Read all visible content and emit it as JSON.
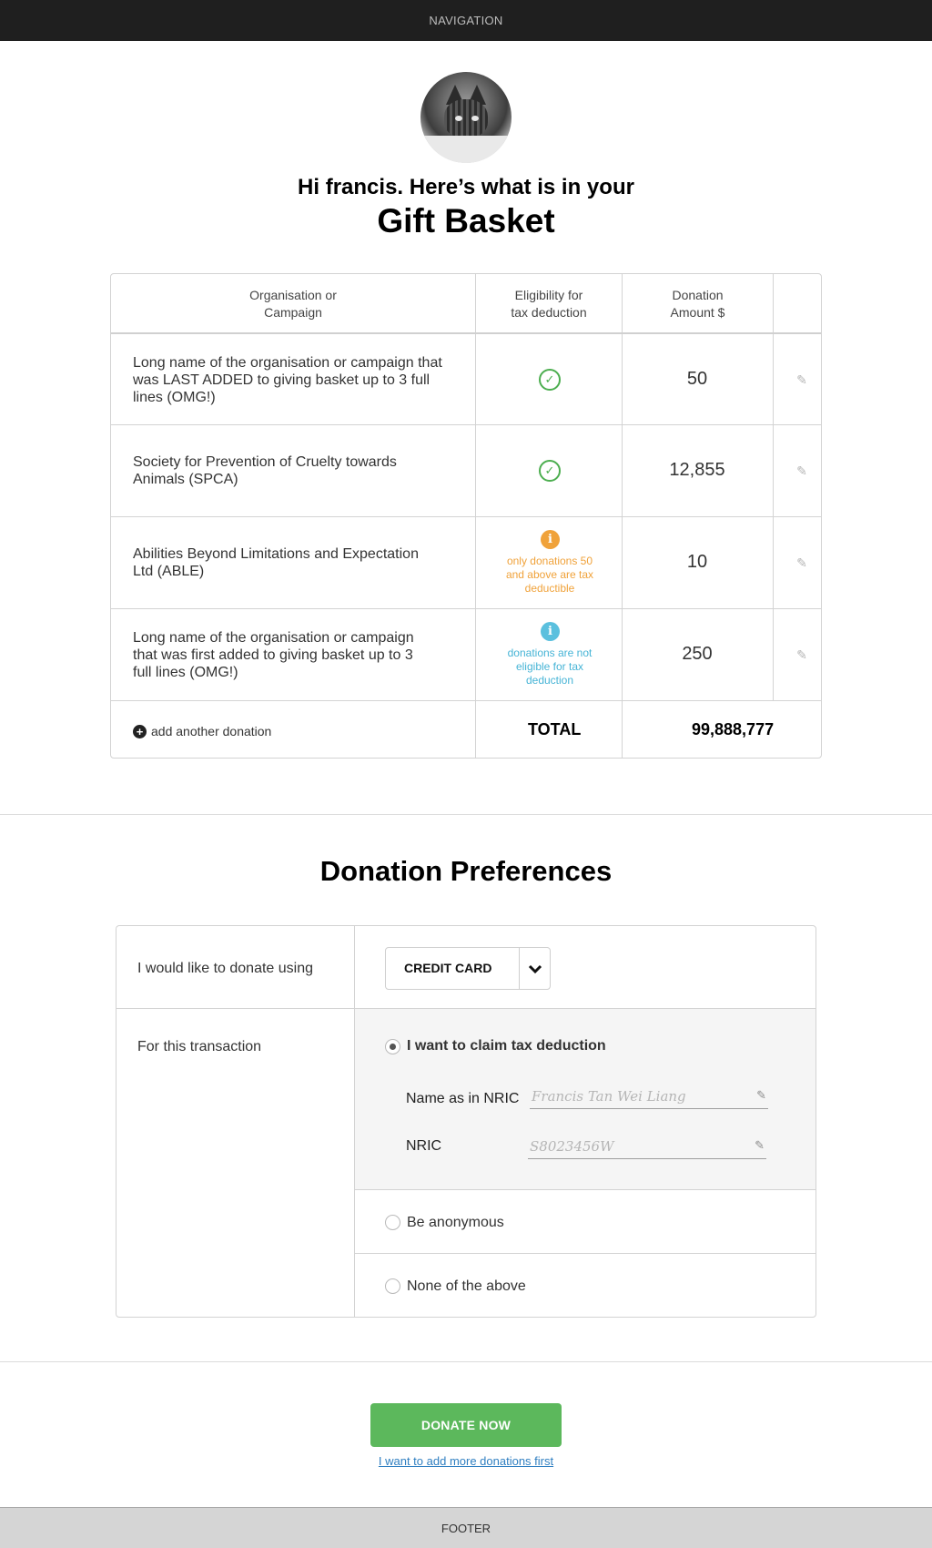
{
  "nav": {
    "label": "NAVIGATION"
  },
  "greeting": {
    "line1": "Hi francis. Here’s what is in your",
    "line2": "Gift Basket"
  },
  "basket": {
    "headers": {
      "org": [
        "Organisation or",
        "Campaign"
      ],
      "elig": [
        "Eligibility for",
        "tax deduction"
      ],
      "amount": [
        "Donation",
        "Amount $"
      ]
    },
    "rows": [
      {
        "name": [
          "Long name of the organisation or campaign that",
          "was LAST ADDED to giving basket up to 3 full",
          "lines (OMG!)"
        ],
        "eligibility": "eligible",
        "note": [],
        "amount": "50"
      },
      {
        "name": [
          "Society for Prevention of Cruelty towards",
          "Animals (SPCA)"
        ],
        "eligibility": "eligible",
        "note": [],
        "amount": "12,855"
      },
      {
        "name": [
          "Abilities Beyond Limitations and Expectation",
          "Ltd (ABLE)"
        ],
        "eligibility": "warning",
        "note": [
          "only donations 50",
          "and above are tax",
          "deductible"
        ],
        "amount": "10"
      },
      {
        "name": [
          "Long name of the organisation or campaign",
          "that was first added to giving basket up to 3",
          "full lines (OMG!)"
        ],
        "eligibility": "ineligible",
        "note": [
          "donations are not",
          "eligible for tax",
          "deduction"
        ],
        "amount": "250"
      }
    ],
    "add_label": "add another donation",
    "total_label": "TOTAL",
    "total_value": "99,888,777"
  },
  "colors": {
    "eligible": "#4cae4f",
    "warning": "#f0a23a",
    "ineligible": "#5bc0de",
    "donate_button": "#5cb85c",
    "link": "#2f7fc1"
  },
  "icons": {
    "eligible": "check-circle-icon",
    "warning": "info-icon",
    "ineligible": "info-icon",
    "edit": "pencil-icon",
    "add": "plus-circle-icon",
    "dropdown": "chevron-down-icon"
  },
  "preferences": {
    "title": "Donation Preferences",
    "method_label": "I would like to donate using",
    "method_value": "CREDIT CARD",
    "transaction_label": "For this transaction",
    "options": [
      {
        "label": "I want to claim tax deduction",
        "selected": true
      },
      {
        "label": "Be anonymous",
        "selected": false
      },
      {
        "label": "None of the above",
        "selected": false
      }
    ],
    "name_label": "Name as in NRIC",
    "name_value": "Francis Tan Wei Liang",
    "nric_label": "NRIC",
    "nric_value": "S8023456W"
  },
  "actions": {
    "donate": "DONATE NOW",
    "more": "I want to add more donations first"
  },
  "footer": {
    "label": "FOOTER"
  }
}
